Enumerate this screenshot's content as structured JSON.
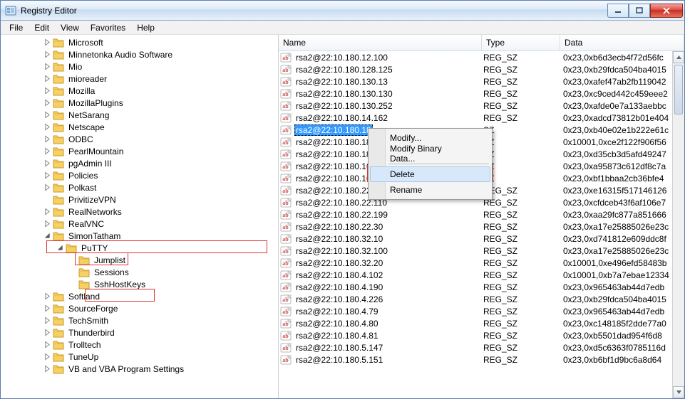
{
  "window": {
    "title": "Registry Editor"
  },
  "menu": {
    "file": "File",
    "edit": "Edit",
    "view": "View",
    "favorites": "Favorites",
    "help": "Help"
  },
  "tree": {
    "items": [
      {
        "indent": 3,
        "expand": "closed",
        "label": "Microsoft"
      },
      {
        "indent": 3,
        "expand": "closed",
        "label": "Minnetonka Audio Software"
      },
      {
        "indent": 3,
        "expand": "closed",
        "label": "Mio"
      },
      {
        "indent": 3,
        "expand": "closed",
        "label": "mioreader"
      },
      {
        "indent": 3,
        "expand": "closed",
        "label": "Mozilla"
      },
      {
        "indent": 3,
        "expand": "closed",
        "label": "MozillaPlugins"
      },
      {
        "indent": 3,
        "expand": "closed",
        "label": "NetSarang"
      },
      {
        "indent": 3,
        "expand": "closed",
        "label": "Netscape"
      },
      {
        "indent": 3,
        "expand": "closed",
        "label": "ODBC"
      },
      {
        "indent": 3,
        "expand": "closed",
        "label": "PearlMountain"
      },
      {
        "indent": 3,
        "expand": "closed",
        "label": "pgAdmin III"
      },
      {
        "indent": 3,
        "expand": "closed",
        "label": "Policies"
      },
      {
        "indent": 3,
        "expand": "closed",
        "label": "Polkast"
      },
      {
        "indent": 3,
        "expand": "none",
        "label": "PrivitizeVPN"
      },
      {
        "indent": 3,
        "expand": "closed",
        "label": "RealNetworks"
      },
      {
        "indent": 3,
        "expand": "closed",
        "label": "RealVNC"
      },
      {
        "indent": 3,
        "expand": "open",
        "label": "SimonTatham"
      },
      {
        "indent": 4,
        "expand": "open",
        "label": "PuTTY",
        "box": "putty"
      },
      {
        "indent": 5,
        "expand": "none",
        "label": "Jumplist"
      },
      {
        "indent": 5,
        "expand": "none",
        "label": "Sessions"
      },
      {
        "indent": 5,
        "expand": "none",
        "label": "SshHostKeys",
        "box": "ssh"
      },
      {
        "indent": 3,
        "expand": "closed",
        "label": "Softland"
      },
      {
        "indent": 3,
        "expand": "closed",
        "label": "SourceForge"
      },
      {
        "indent": 3,
        "expand": "closed",
        "label": "TechSmith"
      },
      {
        "indent": 3,
        "expand": "closed",
        "label": "Thunderbird"
      },
      {
        "indent": 3,
        "expand": "closed",
        "label": "Trolltech"
      },
      {
        "indent": 3,
        "expand": "closed",
        "label": "TuneUp"
      },
      {
        "indent": 3,
        "expand": "closed",
        "label": "VB and VBA Program Settings"
      }
    ]
  },
  "columns": {
    "name": "Name",
    "type": "Type",
    "data": "Data"
  },
  "rows": [
    {
      "name": "rsa2@22:10.180.12.100",
      "type": "REG_SZ",
      "data": "0x23,0xb6d3ecb4f72d56fc",
      "selected": false
    },
    {
      "name": "rsa2@22:10.180.128.125",
      "type": "REG_SZ",
      "data": "0x23,0xb29fdca504ba4015",
      "selected": false
    },
    {
      "name": "rsa2@22:10.180.130.13",
      "type": "REG_SZ",
      "data": "0x23,0xafef47ab2fb119042",
      "selected": false
    },
    {
      "name": "rsa2@22:10.180.130.130",
      "type": "REG_SZ",
      "data": "0x23,0xc9ced442c459eee2",
      "selected": false
    },
    {
      "name": "rsa2@22:10.180.130.252",
      "type": "REG_SZ",
      "data": "0x23,0xafde0e7a133aebbc",
      "selected": false
    },
    {
      "name": "rsa2@22:10.180.14.162",
      "type": "REG_SZ",
      "data": "0x23,0xadcd73812b01e404",
      "selected": false
    },
    {
      "name": "rsa2@22:10.180.18",
      "type": "SZ",
      "data": "0x23,0xb40e02e1b222e61c",
      "selected": true
    },
    {
      "name": "rsa2@22:10.180.18",
      "type": "SZ",
      "data": "0x10001,0xce2f122f906f56",
      "selected": false
    },
    {
      "name": "rsa2@22:10.180.18",
      "type": "SZ",
      "data": "0x23,0xd35cb3d5afd49247",
      "selected": false
    },
    {
      "name": "rsa2@22:10.180.16",
      "type": "SZ",
      "data": "0x23,0xa95873c612df8c7a",
      "selected": false
    },
    {
      "name": "rsa2@22:10.180.16",
      "type": "SZ",
      "data": "0x23,0xbf1bbaa2cb36bfe4",
      "selected": false
    },
    {
      "name": "rsa2@22:10.180.22.104",
      "type": "REG_SZ",
      "data": "0x23,0xe16315f517146126",
      "selected": false
    },
    {
      "name": "rsa2@22:10.180.22.110",
      "type": "REG_SZ",
      "data": "0x23,0xcfdceb43f6af106e7",
      "selected": false
    },
    {
      "name": "rsa2@22:10.180.22.199",
      "type": "REG_SZ",
      "data": "0x23,0xaa29fc877a851666",
      "selected": false
    },
    {
      "name": "rsa2@22:10.180.22.30",
      "type": "REG_SZ",
      "data": "0x23,0xa17e25885026e23c",
      "selected": false
    },
    {
      "name": "rsa2@22:10.180.32.10",
      "type": "REG_SZ",
      "data": "0x23,0xd741812e609ddc8f",
      "selected": false
    },
    {
      "name": "rsa2@22:10.180.32.100",
      "type": "REG_SZ",
      "data": "0x23,0xa17e25885026e23c",
      "selected": false
    },
    {
      "name": "rsa2@22:10.180.32.20",
      "type": "REG_SZ",
      "data": "0x10001,0xe496efd58483b",
      "selected": false
    },
    {
      "name": "rsa2@22:10.180.4.102",
      "type": "REG_SZ",
      "data": "0x10001,0xb7a7ebae12334",
      "selected": false
    },
    {
      "name": "rsa2@22:10.180.4.190",
      "type": "REG_SZ",
      "data": "0x23,0x965463ab44d7edb",
      "selected": false
    },
    {
      "name": "rsa2@22:10.180.4.226",
      "type": "REG_SZ",
      "data": "0x23,0xb29fdca504ba4015",
      "selected": false
    },
    {
      "name": "rsa2@22:10.180.4.79",
      "type": "REG_SZ",
      "data": "0x23,0x965463ab44d7edb",
      "selected": false
    },
    {
      "name": "rsa2@22:10.180.4.80",
      "type": "REG_SZ",
      "data": "0x23,0xc148185f2dde77a0",
      "selected": false
    },
    {
      "name": "rsa2@22:10.180.4.81",
      "type": "REG_SZ",
      "data": "0x23,0xb5501dad954f6d8",
      "selected": false
    },
    {
      "name": "rsa2@22:10.180.5.147",
      "type": "REG_SZ",
      "data": "0x23,0xd5c6363f0785116d",
      "selected": false
    },
    {
      "name": "rsa2@22:10.180.5.151",
      "type": "REG_SZ",
      "data": "0x23,0xb6bf1d9bc6a8d64",
      "selected": false
    }
  ],
  "context_menu": {
    "modify": "Modify...",
    "modify_binary": "Modify Binary Data...",
    "delete": "Delete",
    "rename": "Rename"
  }
}
